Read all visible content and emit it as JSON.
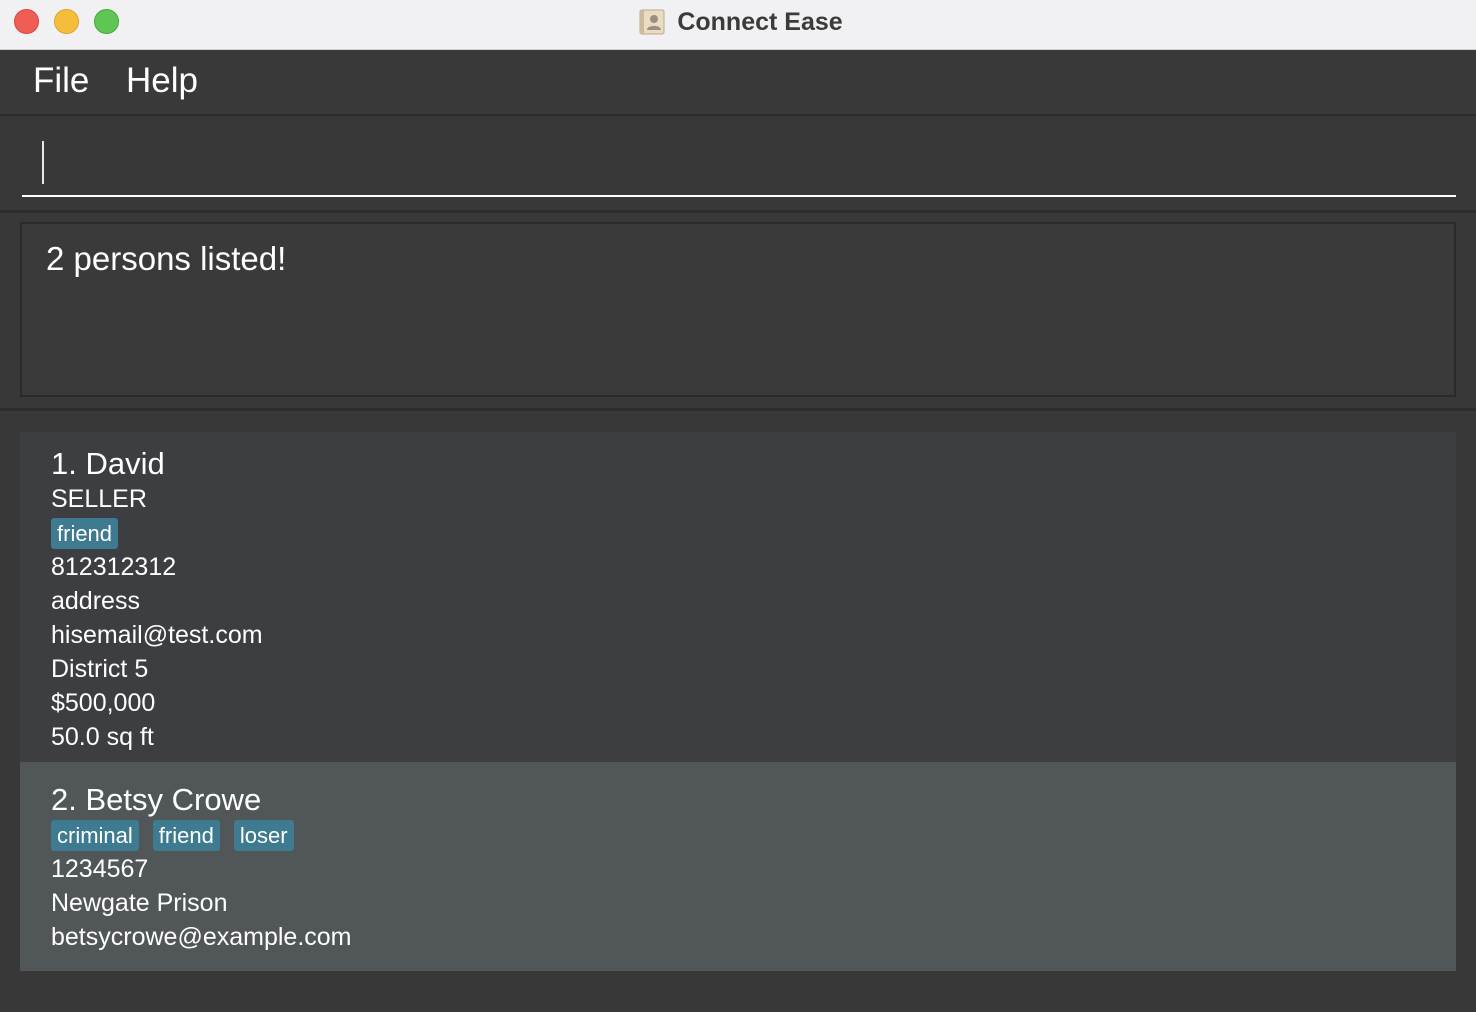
{
  "window": {
    "title": "Connect Ease"
  },
  "menu": {
    "items": [
      "File",
      "Help"
    ]
  },
  "command": {
    "value": "",
    "placeholder": ""
  },
  "result": {
    "message": "2 persons listed!"
  },
  "persons": [
    {
      "index_name": "1. David",
      "role": "SELLER",
      "tags": [
        "friend"
      ],
      "phone": "812312312",
      "address": "address",
      "email": "hisemail@test.com",
      "district": "District 5",
      "price": "$500,000",
      "size": "50.0 sq ft"
    },
    {
      "index_name": "2. Betsy Crowe",
      "tags": [
        "criminal",
        "friend",
        "loser"
      ],
      "phone": "1234567",
      "address": "Newgate Prison",
      "email": "betsycrowe@example.com"
    }
  ],
  "colors": {
    "background": "#383838",
    "titlebar": "#f1f1f3",
    "card_default": "#3d3e41",
    "card_selected": "#515659",
    "tag": "#3e7b91"
  }
}
